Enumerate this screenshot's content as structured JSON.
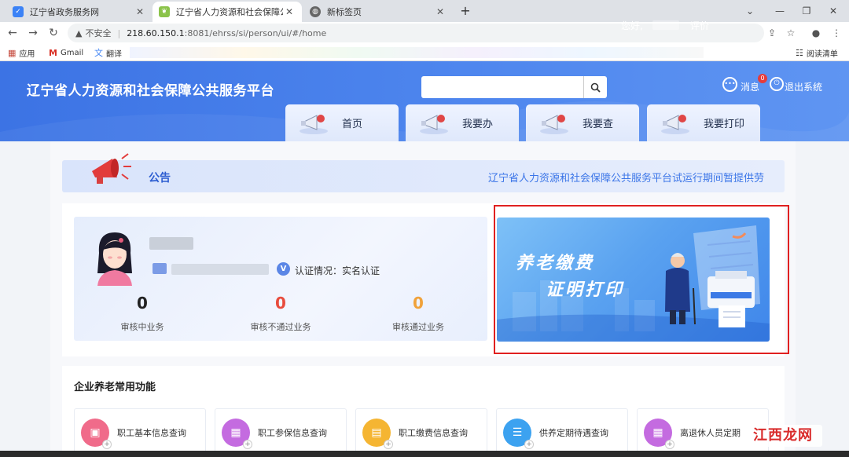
{
  "browser": {
    "tabs": [
      {
        "title": "辽宁省政务服务网",
        "favicon": "shield-icon",
        "active": false
      },
      {
        "title": "辽宁省人力资源和社会保障公共服",
        "favicon": "leaf-icon",
        "active": true
      },
      {
        "title": "新标签页",
        "favicon": "globe-icon",
        "active": false
      }
    ],
    "address": {
      "security_label": "不安全",
      "url_host": "218.60.150.1",
      "url_path": ":8081/ehrss/si/person/ui/#/home"
    },
    "bookmarks": [
      {
        "label": "应用",
        "icon": "apps-grid-icon"
      },
      {
        "label": "Gmail",
        "icon": "gmail-icon"
      },
      {
        "label": "翻译",
        "icon": "translate-icon"
      }
    ],
    "reading_list": "阅读清单"
  },
  "site": {
    "title": "辽宁省人力资源和社会保障公共服务平台",
    "greeting": "您好,",
    "rate_label": "评价",
    "messages_label": "消息",
    "message_count": "0",
    "logout_label": "退出系统",
    "nav_tabs": [
      {
        "label": "首页"
      },
      {
        "label": "我要办"
      },
      {
        "label": "我要查"
      },
      {
        "label": "我要打印"
      }
    ]
  },
  "notice": {
    "title": "公告",
    "text": "辽宁省人力资源和社会保障公共服务平台试运行期间暂提供劳"
  },
  "user": {
    "verification": "认证情况：实名认证",
    "stats": [
      {
        "value": "0",
        "label": "审核中业务",
        "color": "#222222"
      },
      {
        "value": "0",
        "label": "审核不通过业务",
        "color": "#e84c3d"
      },
      {
        "value": "0",
        "label": "审核通过业务",
        "color": "#f0a23b"
      }
    ]
  },
  "promo": {
    "line1": "养老缴费",
    "line2": "证明打印"
  },
  "functions": {
    "heading": "企业养老常用功能",
    "items": [
      {
        "label": "职工基本信息查询",
        "color": "#f06b8a"
      },
      {
        "label": "职工参保信息查询",
        "color": "#c46be0"
      },
      {
        "label": "职工缴费信息查询",
        "color": "#f5b532"
      },
      {
        "label": "供养定期待遇查询",
        "color": "#3ca2f0"
      },
      {
        "label": "离退休人员定期",
        "color": "#c46be0"
      }
    ]
  },
  "watermark": "江西龙网"
}
